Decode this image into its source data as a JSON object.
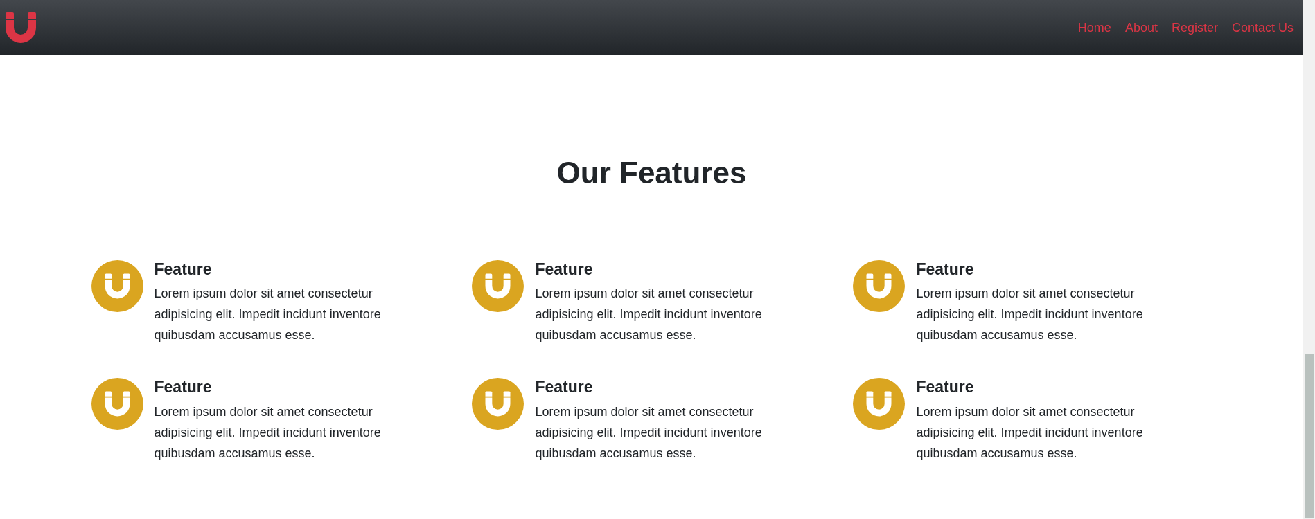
{
  "navbar": {
    "links": [
      {
        "label": "Home"
      },
      {
        "label": "About"
      },
      {
        "label": "Register"
      },
      {
        "label": "Contact Us"
      }
    ]
  },
  "section": {
    "title": "Our Features"
  },
  "features": [
    {
      "title": "Feature",
      "text": "Lorem ipsum dolor sit amet consectetur adipisicing elit. Impedit incidunt inventore quibusdam accusamus esse."
    },
    {
      "title": "Feature",
      "text": "Lorem ipsum dolor sit amet consectetur adipisicing elit. Impedit incidunt inventore quibusdam accusamus esse."
    },
    {
      "title": "Feature",
      "text": "Lorem ipsum dolor sit amet consectetur adipisicing elit. Impedit incidunt inventore quibusdam accusamus esse."
    },
    {
      "title": "Feature",
      "text": "Lorem ipsum dolor sit amet consectetur adipisicing elit. Impedit incidunt inventore quibusdam accusamus esse."
    },
    {
      "title": "Feature",
      "text": "Lorem ipsum dolor sit amet consectetur adipisicing elit. Impedit incidunt inventore quibusdam accusamus esse."
    },
    {
      "title": "Feature",
      "text": "Lorem ipsum dolor sit amet consectetur adipisicing elit. Impedit incidunt inventore quibusdam accusamus esse."
    }
  ]
}
